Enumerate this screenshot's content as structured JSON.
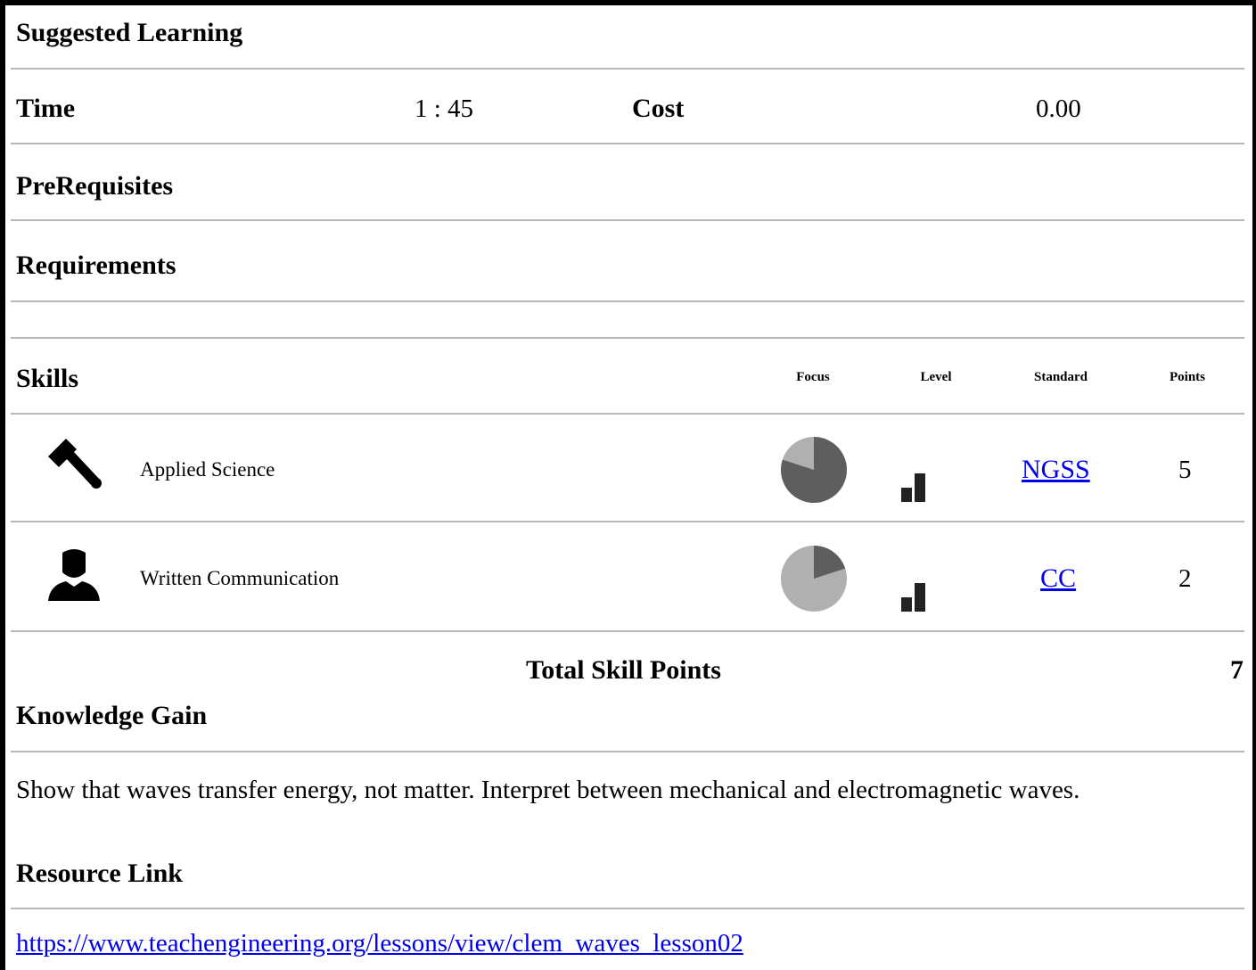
{
  "suggested_learning": {
    "title": "Suggested Learning"
  },
  "time": {
    "label": "Time",
    "value": "1 : 45"
  },
  "cost": {
    "label": "Cost",
    "value": "0.00"
  },
  "prerequisites": {
    "label": "PreRequisites"
  },
  "requirements": {
    "label": "Requirements"
  },
  "skills": {
    "label": "Skills",
    "columns": {
      "focus": "Focus",
      "level": "Level",
      "standard": "Standard",
      "points": "Points"
    },
    "rows": [
      {
        "name": "Applied Science",
        "icon": "hammer-icon",
        "focus_fraction": 0.8,
        "level": 2,
        "standard": "NGSS",
        "points": "5"
      },
      {
        "name": "Written Communication",
        "icon": "person-icon",
        "focus_fraction": 0.2,
        "level": 2,
        "standard": "CC",
        "points": "2"
      }
    ],
    "total_label": "Total Skill Points",
    "total_value": "7"
  },
  "knowledge_gain": {
    "label": "Knowledge Gain",
    "text": "Show that waves transfer energy, not matter. Interpret between mechanical and electromagnetic waves."
  },
  "resource_link": {
    "label": "Resource Link",
    "url": "https://www.teachengineering.org/lessons/view/clem_waves_lesson02"
  },
  "colors": {
    "pie_dark": "#5e5e5e",
    "pie_light": "#b0b0b0",
    "rule": "#b8b8b8",
    "link": "#0000ee"
  }
}
